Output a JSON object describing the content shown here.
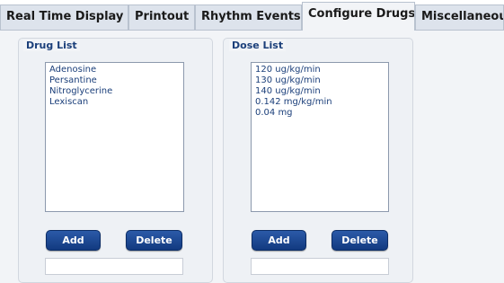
{
  "tabs": [
    {
      "label": "Real Time Display",
      "active": false
    },
    {
      "label": "Printout",
      "active": false
    },
    {
      "label": "Rhythm Events",
      "active": false
    },
    {
      "label": "Configure Drugs",
      "active": true
    },
    {
      "label": "Miscellaneous",
      "active": false
    }
  ],
  "drug_panel": {
    "title": "Drug List",
    "items": [
      "Adenosine",
      "Persantine",
      "Nitroglycerine",
      "Lexiscan"
    ],
    "add_label": "Add",
    "delete_label": "Delete",
    "input_value": ""
  },
  "dose_panel": {
    "title": "Dose List",
    "items": [
      "120 ug/kg/min",
      "130 ug/kg/min",
      "140 ug/kg/min",
      "0.142 mg/kg/min",
      "0.04 mg"
    ],
    "add_label": "Add",
    "delete_label": "Delete",
    "input_value": ""
  },
  "colors": {
    "accent": "#1b3f7a",
    "button": "#123a80",
    "panel_bg": "#f2f4f7",
    "tab_bg": "#dde3ec"
  }
}
